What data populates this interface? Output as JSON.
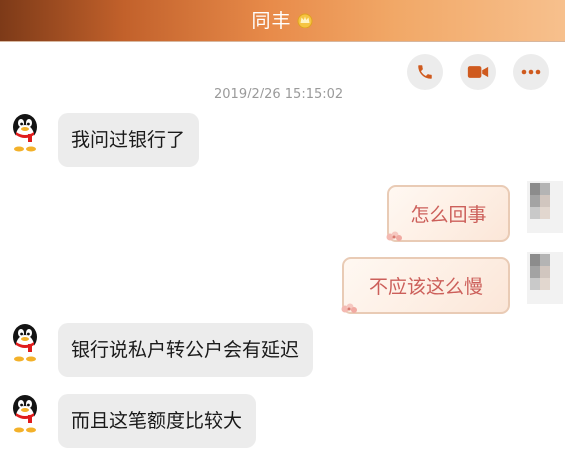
{
  "header": {
    "contact_name": "同丰"
  },
  "toolbar": {
    "call_icon": "phone-icon",
    "video_icon": "video-camera-icon",
    "more_icon": "more-dots-icon"
  },
  "timestamp": "2019/2/26 15:15:02",
  "messages": [
    {
      "side": "incoming",
      "text": "我问过银行了"
    },
    {
      "side": "outgoing",
      "text": "怎么回事"
    },
    {
      "side": "outgoing",
      "text": "不应该这么慢"
    },
    {
      "side": "incoming",
      "text": "银行说私户转公户会有延迟"
    },
    {
      "side": "incoming",
      "text": "而且这笔额度比较大"
    }
  ],
  "colors": {
    "header_gradient_start": "#7d3a18",
    "header_gradient_end": "#f7c08d",
    "incoming_bubble": "#ececec",
    "outgoing_text": "#cc5f5a",
    "outgoing_border": "#e9cbb5"
  }
}
